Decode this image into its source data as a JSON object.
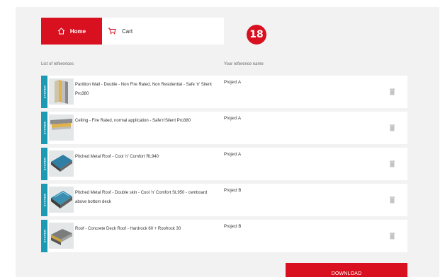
{
  "nav": {
    "home_label": "Home",
    "cart_label": "Cart"
  },
  "step_badge": "18",
  "columns": {
    "references": "List of references",
    "reference_name": "Your reference name"
  },
  "rows": [
    {
      "tag": "SYSTEM",
      "title": "Partition Wall - Double - Non Fire Rated, Non Residential - Safe 'n' Silent Pro380",
      "reference": "Project A"
    },
    {
      "tag": "SYSTEM",
      "title": "Ceiling - Fire Rated, normal application - Safe'n'Silent Pro380",
      "reference": "Project A"
    },
    {
      "tag": "SYSTEM",
      "title": "Pitched Metal Roof - Cool 'n' Comfort RL940",
      "reference": "Project A"
    },
    {
      "tag": "SYSTEM",
      "title": "Pitched Metal Roof - Double skin - Cool 'n' Comfort SL950 - cemboard above bottom deck",
      "reference": "Project B"
    },
    {
      "tag": "SYSTEM",
      "title": "Roof - Concrete Deck Roof - Hardrock 60 + Roofrock 30",
      "reference": "Project B"
    }
  ],
  "download_label": "DOWNLOAD",
  "colors": {
    "brand_red": "#d8101f",
    "tag_teal": "#1c9ab3",
    "panel_bg": "#f2f2f2"
  },
  "icons": {
    "home": "home-icon",
    "cart": "cart-icon",
    "delete": "trash-icon"
  }
}
